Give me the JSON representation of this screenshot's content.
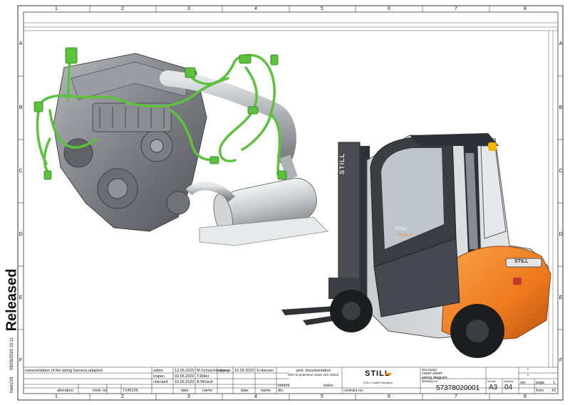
{
  "frame": {
    "columns": [
      "1",
      "2",
      "3",
      "4",
      "5",
      "6",
      "7",
      "8"
    ],
    "rows": [
      "A",
      "B",
      "C",
      "D",
      "E",
      "F"
    ]
  },
  "side": {
    "status": "Released",
    "date": "09/09/2020  10:11",
    "code": "fowk219"
  },
  "title_block": {
    "revision_text": "representation of the wiring harness adapted",
    "editor_label": "editor",
    "inspec_label": "inspec.",
    "checked_label": "checked",
    "editor_date": "13.05.2020",
    "editor_name": "M.Schwichtenberg",
    "inspec_date": "03.06.2020",
    "inspec_name": "T.Ritter",
    "checked_date": "15.06.2020",
    "checked_name": "A.Winsch",
    "approv_label": "approv.",
    "approv_date": "16.06.2020",
    "approv_name": "S.Hansen",
    "prot_doc": "prot. documentation",
    "prot_ref": "refer to protection notice ISO 16016",
    "source_label": "source",
    "index_label": "index:",
    "contract_label": "contract no.",
    "alteration_label": "alteration",
    "modno_label": "mod.-no.",
    "modno_value": "T145105",
    "date_label": "date",
    "name_label": "name",
    "date_label2": "date",
    "name_label2": "name",
    "div_label": "div.",
    "brand": "STILL",
    "brand_sub": "STILL GmbH Hamburg",
    "desc_label": "description",
    "desc_line1": "cover sheet",
    "desc_line2": "wiring diagram",
    "drawing_no_label": "drawing no.",
    "drawing_no": "57378020001",
    "format_label": "format",
    "format": "A3",
    "version_label": "revised",
    "version": "04",
    "ver_label": "ver.",
    "page_label": "page",
    "page": "1",
    "from_label": "from",
    "from": "16",
    "star1": "*",
    "star2": "*"
  },
  "truck": {
    "mast_label": "STILL",
    "door_label": "STILL",
    "door_model": "RX60-25",
    "counterweight_label": "STILL"
  },
  "colors": {
    "harness": "#5cc23c",
    "engine": "#8a8d91",
    "truck_orange": "#ee7a1e",
    "truck_dark": "#3a3d42",
    "brand_orange": "#f28c00"
  }
}
